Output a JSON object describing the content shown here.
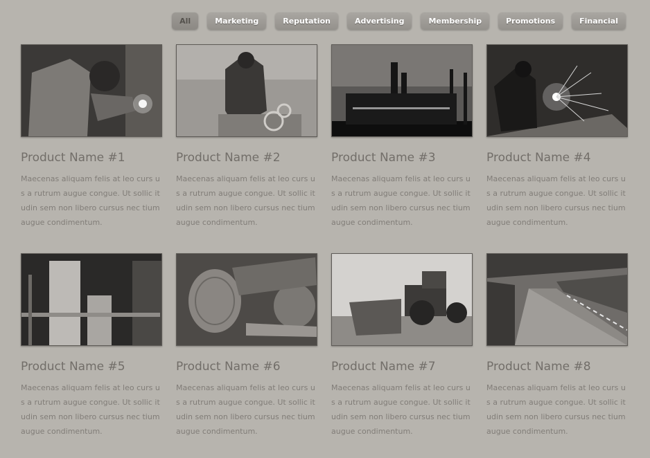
{
  "filters": [
    "All",
    "Marketing",
    "Reputation",
    "Advertising",
    "Membership",
    "Promotions",
    "Financial"
  ],
  "products": [
    {
      "name": "Product Name #1",
      "description": "Maecenas aliquam felis at leo curs us a rutrum augue congue. Ut sollic itudin sem non libero cursus nec tium augue condimentum."
    },
    {
      "name": "Product Name #2",
      "description": "Maecenas aliquam felis at leo curs us a rutrum augue congue. Ut sollic itudin sem non libero cursus nec tium augue condimentum."
    },
    {
      "name": "Product Name #3",
      "description": "Maecenas aliquam felis at leo curs us a rutrum augue congue. Ut sollic itudin sem non libero cursus nec tium augue condimentum."
    },
    {
      "name": "Product Name #4",
      "description": "Maecenas aliquam felis at leo curs us a rutrum augue congue. Ut sollic itudin sem non libero cursus nec tium augue condimentum."
    },
    {
      "name": "Product Name #5",
      "description": "Maecenas aliquam felis at leo curs us a rutrum augue congue. Ut sollic itudin sem non libero cursus nec tium augue condimentum."
    },
    {
      "name": "Product Name #6",
      "description": "Maecenas aliquam felis at leo curs us a rutrum augue congue. Ut sollic itudin sem non libero cursus nec tium augue condimentum."
    },
    {
      "name": "Product Name #7",
      "description": "Maecenas aliquam felis at leo curs us a rutrum augue congue. Ut sollic itudin sem non libero cursus nec tium augue condimentum."
    },
    {
      "name": "Product Name #8",
      "description": "Maecenas aliquam felis at leo curs us a rutrum augue congue. Ut sollic itudin sem non libero cursus nec tium augue condimentum."
    }
  ]
}
